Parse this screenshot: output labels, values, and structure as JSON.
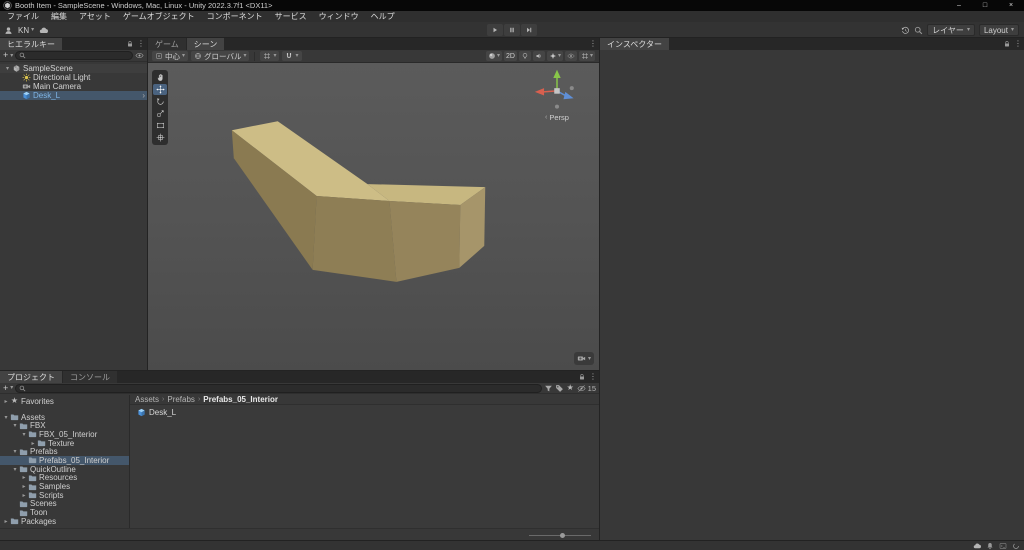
{
  "window": {
    "title": "Booth Item - SampleScene - Windows, Mac, Linux - Unity 2022.3.7f1 <DX11>",
    "minimize_glyph": "–",
    "maximize_glyph": "□",
    "close_glyph": "×"
  },
  "menu_bar": [
    {
      "key": "file",
      "label": "ファイル"
    },
    {
      "key": "edit",
      "label": "編集"
    },
    {
      "key": "assets",
      "label": "アセット"
    },
    {
      "key": "gameobject",
      "label": "ゲームオブジェクト"
    },
    {
      "key": "component",
      "label": "コンポーネント"
    },
    {
      "key": "services",
      "label": "サービス"
    },
    {
      "key": "window",
      "label": "ウィンドウ"
    },
    {
      "key": "help",
      "label": "ヘルプ"
    }
  ],
  "toolbar": {
    "account_label": "KN",
    "layers_label": "レイヤー",
    "layout_label": "Layout"
  },
  "hierarchy": {
    "tab_label": "ヒエラルキー",
    "create_label": "+",
    "search_placeholder": "",
    "items": [
      {
        "label": "SampleScene",
        "icon": "unity-scene",
        "depth": 0,
        "expanded": true,
        "kind": "scene"
      },
      {
        "label": "Directional Light",
        "icon": "light",
        "depth": 1
      },
      {
        "label": "Main Camera",
        "icon": "camera",
        "depth": 1
      },
      {
        "label": "Desk_L",
        "icon": "prefab",
        "depth": 1,
        "selected": true,
        "prefab": true,
        "chevron": true
      }
    ]
  },
  "scene_view": {
    "tabs": [
      {
        "key": "game",
        "label": "ゲーム",
        "active": false
      },
      {
        "key": "scene",
        "label": "シーン",
        "active": true
      }
    ],
    "pivot_label": "中心",
    "space_label": "グローバル",
    "toggles": [
      {
        "name": "shading-mode",
        "icon": "shaded-sphere",
        "caret": true
      },
      {
        "name": "2d-view",
        "label": "2D"
      },
      {
        "name": "scene-lighting",
        "icon": "lightbulb"
      },
      {
        "name": "scene-audio",
        "icon": "audio"
      },
      {
        "name": "scene-effects",
        "icon": "effects",
        "caret": true
      },
      {
        "name": "scene-visibility",
        "icon": "eye"
      },
      {
        "name": "grid-visibility",
        "icon": "grid",
        "caret": true
      }
    ],
    "tools": [
      "hand",
      "move",
      "rotate",
      "scale",
      "rect",
      "transform"
    ],
    "active_tool": "move",
    "gizmo_label": "Persp"
  },
  "inspector": {
    "tab_label": "インスペクター"
  },
  "project": {
    "tabs": [
      {
        "key": "project",
        "label": "プロジェクト",
        "active": true
      },
      {
        "key": "console",
        "label": "コンソール",
        "active": false
      }
    ],
    "create_label": "+",
    "search_placeholder": "",
    "hidden_count": "15",
    "tree": [
      {
        "label": "Favorites",
        "icon": "star",
        "depth": 0,
        "arrow": "collapsed"
      },
      {
        "type": "spacer"
      },
      {
        "label": "Assets",
        "icon": "folder",
        "depth": 0,
        "arrow": "expanded"
      },
      {
        "label": "FBX",
        "icon": "folder",
        "depth": 1,
        "arrow": "expanded"
      },
      {
        "label": "FBX_05_Interior",
        "icon": "folder",
        "depth": 2,
        "arrow": "expanded"
      },
      {
        "label": "Texture",
        "icon": "folder",
        "depth": 3,
        "arrow": "collapsed"
      },
      {
        "label": "Prefabs",
        "icon": "folder",
        "depth": 1,
        "arrow": "expanded"
      },
      {
        "label": "Prefabs_05_Interior",
        "icon": "folder",
        "depth": 2,
        "arrow": "none",
        "selected": true
      },
      {
        "label": "QuickOutline",
        "icon": "folder",
        "depth": 1,
        "arrow": "expanded"
      },
      {
        "label": "Resources",
        "icon": "folder",
        "depth": 2,
        "arrow": "collapsed"
      },
      {
        "label": "Samples",
        "icon": "folder",
        "depth": 2,
        "arrow": "collapsed"
      },
      {
        "label": "Scripts",
        "icon": "folder",
        "depth": 2,
        "arrow": "collapsed"
      },
      {
        "label": "Scenes",
        "icon": "folder",
        "depth": 1,
        "arrow": "none"
      },
      {
        "label": "Toon",
        "icon": "folder",
        "depth": 1,
        "arrow": "none"
      },
      {
        "label": "Packages",
        "icon": "folder",
        "depth": 0,
        "arrow": "collapsed"
      }
    ],
    "breadcrumbs": [
      "Assets",
      "Prefabs",
      "Prefabs_05_Interior"
    ],
    "assets": [
      {
        "label": "Desk_L",
        "icon": "prefab"
      }
    ]
  },
  "status_bar": {
    "icons": [
      "cloud",
      "bell",
      "console",
      "progress"
    ]
  }
}
